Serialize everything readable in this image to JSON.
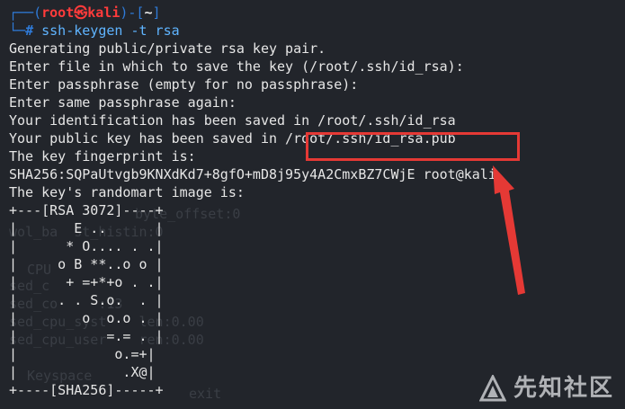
{
  "prompt": {
    "top_left": "┌──(",
    "user_host": "root㉿kali",
    "mid": ")-[",
    "path": "~",
    "top_right": "]",
    "bottom_left": "└─",
    "hash": "#",
    "command": "ssh-keygen -t rsa"
  },
  "output": [
    "Generating public/private rsa key pair.",
    "Enter file in which to save the key (/root/.ssh/id_rsa):",
    "Enter passphrase (empty for no passphrase):",
    "Enter same passphrase again:",
    "Your identification has been saved in /root/.ssh/id_rsa",
    "Your public key has been saved in /root/.ssh/id_rsa.pub",
    "The key fingerprint is:",
    "SHA256:SQPaUtvgb9KNXdKd7+8gfO+mD8j95y4A2CmxBZ7CWjE root@kali",
    "The key's randomart image is:"
  ],
  "randomart": [
    "+---[RSA 3072]----+",
    "|       E ..      |",
    "|      * O.... . .|",
    "|     o B **..o o |",
    "|      + =+*+o . .|",
    "|     . . S.o.  . |",
    "|        o  o.o . |",
    "|           =.= . |",
    "|            o.=+|",
    "|             .X@|",
    "+----[SHA256]-----+"
  ],
  "ghost_text": [
    "byte_offset:0",
    "wol_ba  st_histin:0",
    "CPU",
    "sed_c",
    "sed_co     :13",
    "sed_cpu_syst    len:0.00",
    "sed_cpu_user    ren:0.00",
    "Keyspace",
    "exit"
  ],
  "annotation": {
    "color": "#e53935"
  },
  "watermark": {
    "text": "先知社区",
    "logo_icon": "xianzhi-logo-icon"
  }
}
